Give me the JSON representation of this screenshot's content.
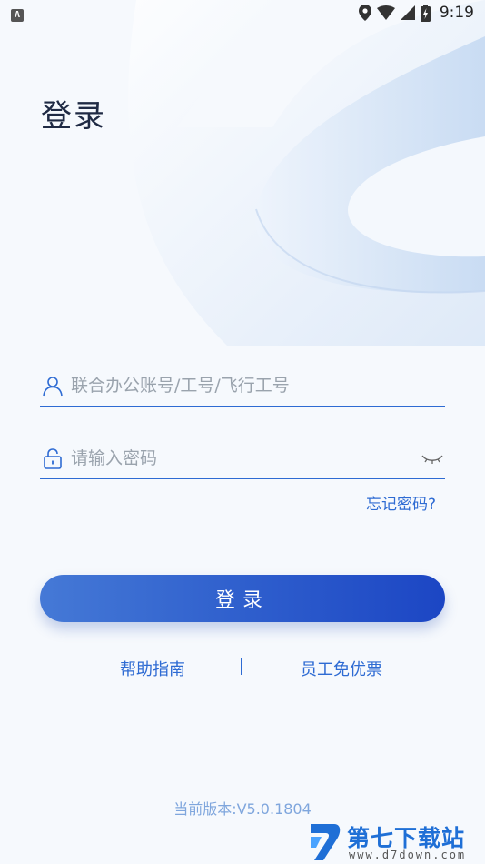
{
  "status_bar": {
    "notification_icon": "A",
    "time": "9:19",
    "icons": [
      "location-icon",
      "wifi-icon",
      "signal-icon",
      "battery-charging-icon"
    ]
  },
  "page": {
    "title": "登录"
  },
  "form": {
    "account_placeholder": "联合办公账号/工号/飞行工号",
    "password_placeholder": "请输入密码",
    "forgot_label": "忘记密码?",
    "login_label": "登录"
  },
  "links": {
    "help": "帮助指南",
    "separator": "|",
    "staff_ticket": "员工免优票"
  },
  "footer": {
    "version": "当前版本:V5.0.1804"
  },
  "watermark": {
    "title": "第七下载站",
    "url": "www.d7down.com"
  },
  "colors": {
    "accent": "#2e6bd3",
    "title": "#1f2a44",
    "background": "#f6f9fd"
  }
}
